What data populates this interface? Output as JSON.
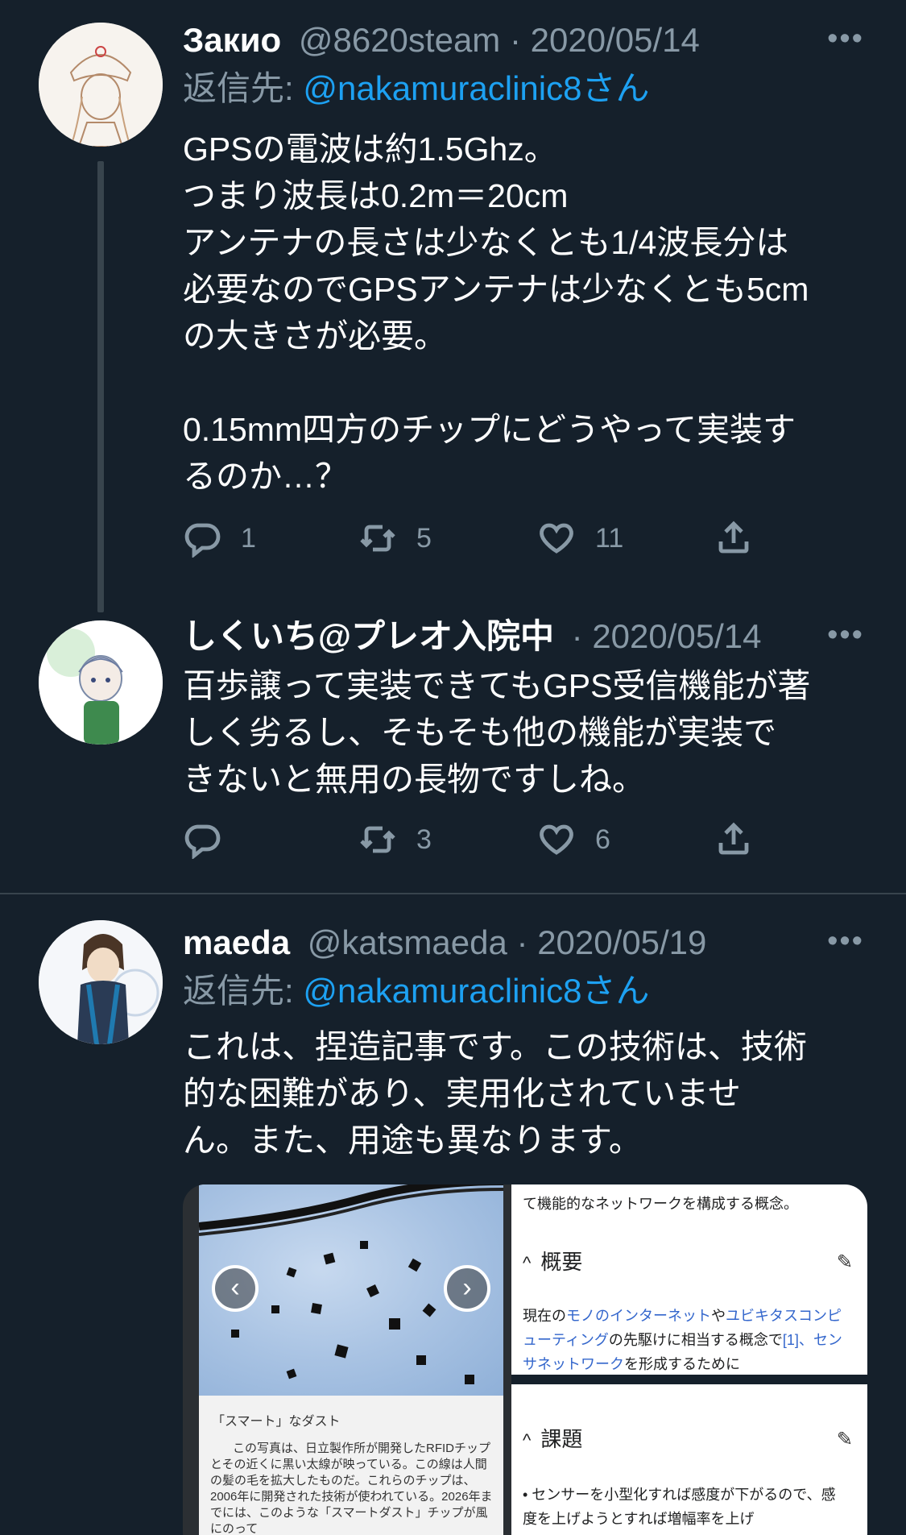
{
  "tweets": [
    {
      "name": "Закио",
      "handle": "@8620steam",
      "sep": "·",
      "date": "2020/05/14",
      "reply_prefix": "返信先:",
      "reply_mention": "@nakamuraclinic8さん",
      "text": "GPSの電波は約1.5Ghz。\nつまり波長は0.2m＝20cm\nアンテナの長さは少なくとも1/4波長分は\n必要なのでGPSアンテナは少なくとも5cm\nの大きさが必要。\n\n0.15mm四方のチップにどうやって実装す\nるのか…？",
      "reply_count": "1",
      "retweet_count": "5",
      "like_count": "11"
    },
    {
      "name": "しくいち@プレオ入院中",
      "sep": "·",
      "date": "2020/05/14",
      "text": "百歩譲って実装できてもGPS受信機能が著\nしく劣るし、そもそも他の機能が実装で\nきないと無用の長物ですしね。",
      "reply_count": "",
      "retweet_count": "3",
      "like_count": "6"
    },
    {
      "name": "maeda",
      "handle": "@katsmaeda",
      "sep": "·",
      "date": "2020/05/19",
      "reply_prefix": "返信先:",
      "reply_mention": "@nakamuraclinic8さん",
      "text": "これは、捏造記事です。この技術は、技術\n的な困難があり、実用化されていませ\nん。また、用途も異なります。"
    }
  ],
  "media": {
    "caption_title": "「スマート」なダスト",
    "caption_body": "この写真は、日立製作所が開発したRFIDチップとその近くに黒い太線が映っている。この線は人間の髪の毛を拡大したものだ。これらのチップは、2006年に開発された技術が使われている。2026年までには、このような「スマートダスト」チップが風にのって",
    "wiki_top": "て機能的なネットワークを構成する概念。",
    "section1": "概要",
    "p1_a": "現在の",
    "p1_link1": "モノのインターネット",
    "p1_b": "や",
    "p1_link2": "ユビキタスコンピューティング",
    "p1_c": "の先駆けに相当する概念で",
    "p1_d": "[1]、",
    "p1_link3": "センサネットワーク",
    "p1_e": "を形成するために",
    "section2": "課題",
    "p2": "• センサーを小型化すれば感度が下がるので、感度を上げようとすれば増幅率を上げ"
  },
  "icons": {
    "reply": "reply-icon",
    "retweet": "retweet-icon",
    "like": "heart-icon",
    "share": "share-icon",
    "more": "more-icon"
  },
  "colors": {
    "background": "#15202b",
    "secondary_text": "#8899a6",
    "link": "#1da1f2",
    "divider": "#38444d"
  }
}
